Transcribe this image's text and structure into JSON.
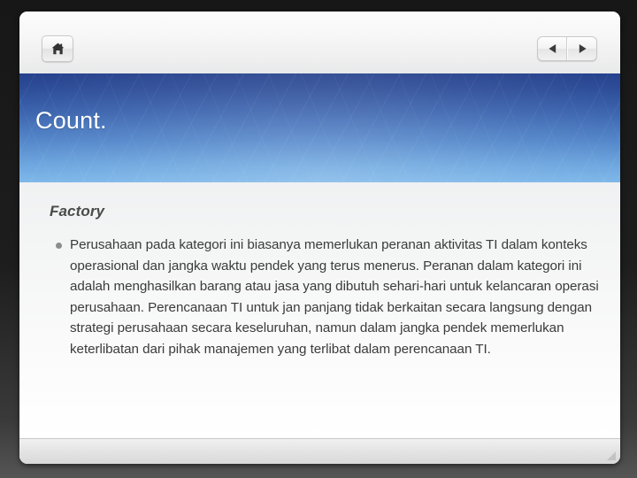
{
  "window": {
    "background_color": "#1b1b1b",
    "panel_color": "#ffffff"
  },
  "toolbar": {
    "home_button": {
      "label": "Home",
      "icon": "home-icon"
    },
    "nav_prev": {
      "label": "Previous",
      "icon": "triangle-left-icon"
    },
    "nav_next": {
      "label": "Next",
      "icon": "triangle-right-icon"
    }
  },
  "slide": {
    "title": "Count.",
    "title_color": "#ffffff",
    "banner_gradient_top": "#24408c",
    "banner_gradient_bottom": "#7cb6e9",
    "heading": "Factory",
    "heading_color": "#4a4a4a",
    "bullets": [
      "Perusahaan pada kategori  ini biasanya memerlukan peranan aktivitas TI dalam konteks  operasional dan jangka  waktu  pendek yang  terus  menerus. Peranan dalam   kategori   ini  adalah menghasilkan  barang   atau  jasa   yang  dibutuh sehari-hari untuk kelancaran operasi  perusahaan. Perencanaan TI untuk jan panjang tidak   berkaitan  secara   langsung  dengan   strategi   perusahaan secara keseluruhan, namun  dalam  jangka pendek  memerlukan keterlibatan dari  pihak manajemen yang terlibat  dalam perencanaan TI."
    ],
    "bullet_color": "#8c8c8c",
    "body_text_color": "#3b3b3b"
  },
  "status_bar": {
    "resize_grip": "resize-grip-icon"
  }
}
